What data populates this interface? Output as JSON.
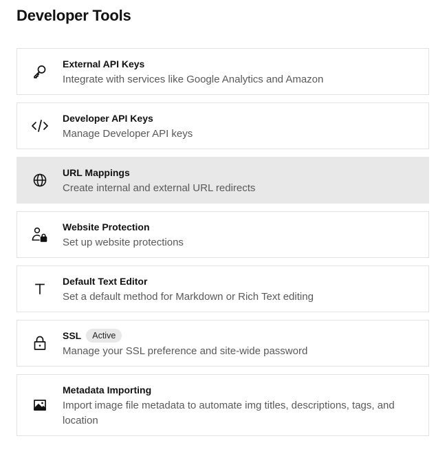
{
  "page": {
    "title": "Developer Tools"
  },
  "items": [
    {
      "id": "external-api-keys",
      "icon": "key-icon",
      "title": "External API Keys",
      "description": "Integrate with services like Google Analytics and Amazon"
    },
    {
      "id": "developer-api-keys",
      "icon": "code-icon",
      "title": "Developer API Keys",
      "description": "Manage Developer API keys"
    },
    {
      "id": "url-mappings",
      "icon": "globe-icon",
      "title": "URL Mappings",
      "description": "Create internal and external URL redirects",
      "state": "hovered"
    },
    {
      "id": "website-protection",
      "icon": "user-lock-icon",
      "title": "Website Protection",
      "description": "Set up website protections"
    },
    {
      "id": "default-text-editor",
      "icon": "text-icon",
      "title": "Default Text Editor",
      "description": "Set a default method for Markdown or Rich Text editing"
    },
    {
      "id": "ssl",
      "icon": "lock-icon",
      "title": "SSL",
      "badge": "Active",
      "description": "Manage your SSL preference and site-wide password"
    },
    {
      "id": "metadata-importing",
      "icon": "image-icon",
      "title": "Metadata Importing",
      "description": "Import image file metadata to automate img titles, descriptions, tags, and location"
    }
  ],
  "colors": {
    "text": "#111111",
    "muted": "#595959",
    "border": "#e2e2e2",
    "hover_bg": "#e8e8e8",
    "badge_bg": "#e8e8e8"
  }
}
